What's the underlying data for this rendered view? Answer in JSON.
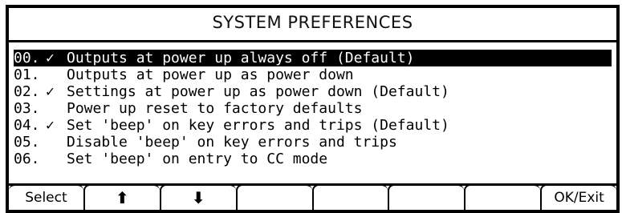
{
  "title": "SYSTEM PREFERENCES",
  "items": [
    {
      "num": "00.",
      "check": "✓",
      "text": "Outputs at power up always off (Default)",
      "selected": true
    },
    {
      "num": "01.",
      "check": "",
      "text": "Outputs at power up as power down",
      "selected": false
    },
    {
      "num": "02.",
      "check": "✓",
      "text": "Settings at power up as power down (Default)",
      "selected": false
    },
    {
      "num": "03.",
      "check": "",
      "text": "Power up reset to factory defaults",
      "selected": false
    },
    {
      "num": "04.",
      "check": "✓",
      "text": "Set 'beep' on key errors and trips (Default)",
      "selected": false
    },
    {
      "num": "05.",
      "check": "",
      "text": "Disable 'beep' on key errors and trips",
      "selected": false
    },
    {
      "num": "06.",
      "check": "",
      "text": "Set 'beep' on entry to CC mode",
      "selected": false
    }
  ],
  "softkeys": {
    "select": "Select",
    "up_icon": "arrow-up-icon",
    "up_glyph": "⬆",
    "down_icon": "arrow-down-icon",
    "down_glyph": "⬇",
    "ok_exit": "OK/Exit"
  }
}
